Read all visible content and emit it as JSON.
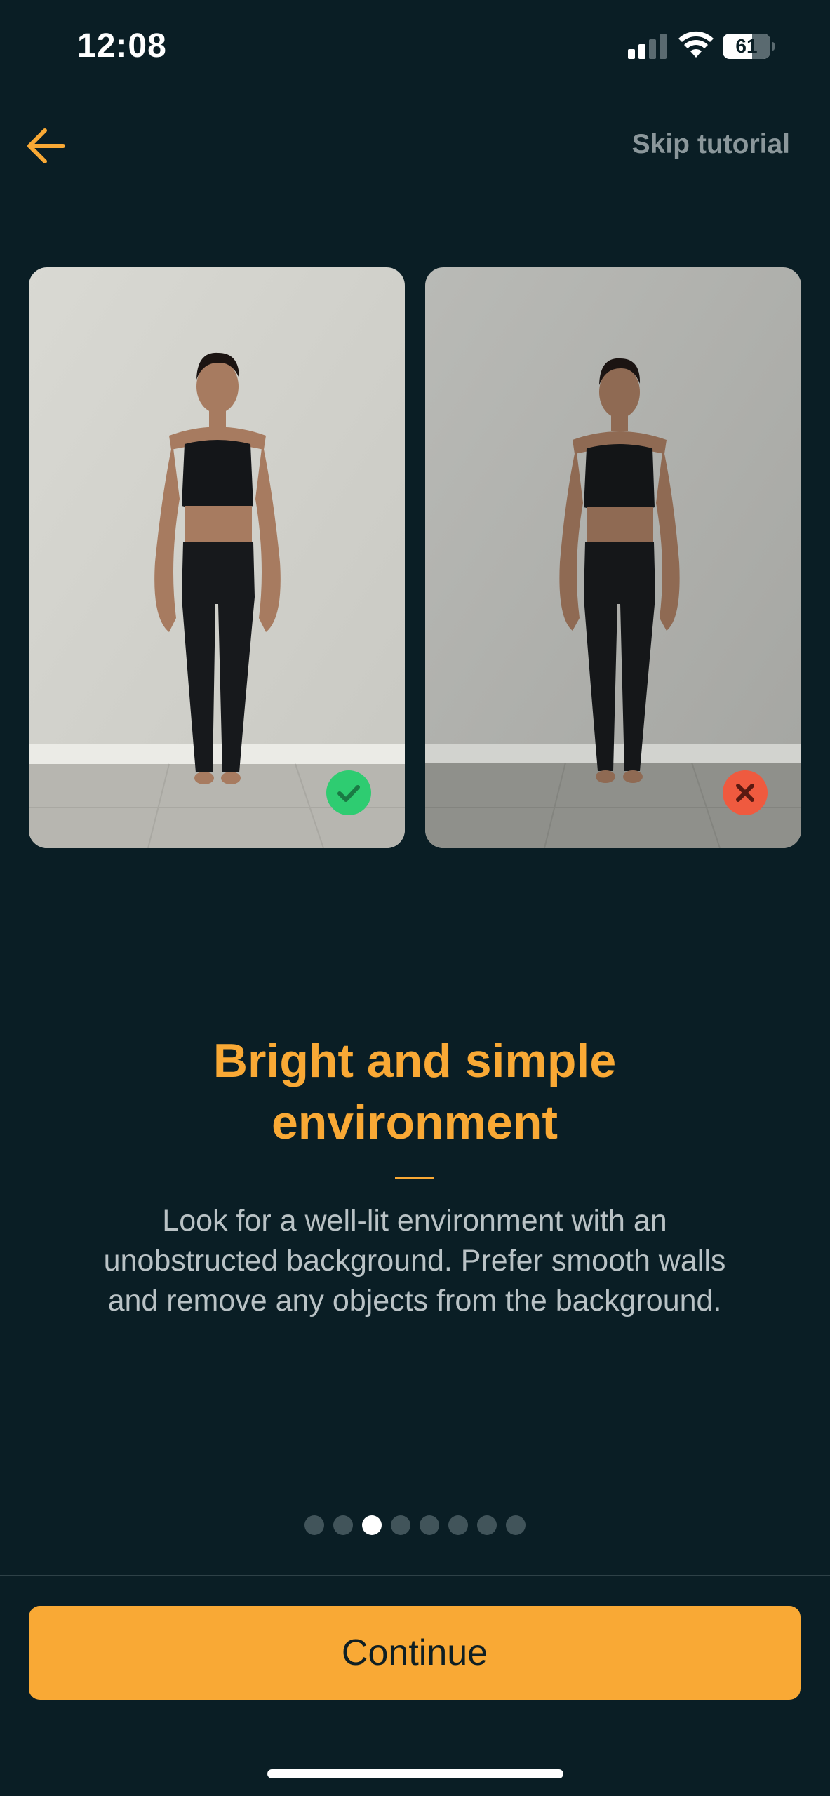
{
  "status_bar": {
    "time": "12:08",
    "battery_level": "61",
    "icons": [
      "signal-icon",
      "wifi-icon",
      "battery-icon"
    ]
  },
  "nav": {
    "back_icon": "arrow-left-icon",
    "skip_label": "Skip tutorial"
  },
  "photos": {
    "good_badge_icon": "check-icon",
    "bad_badge_icon": "close-icon"
  },
  "content": {
    "title_line1": "Bright and simple",
    "title_line2": "environment",
    "description": "Look for a well-lit environment with an unobstructed background. Prefer smooth walls and remove any objects from the background."
  },
  "pagination": {
    "total": 8,
    "current": 3
  },
  "continue_label": "Continue",
  "colors": {
    "background": "#0a1e25",
    "accent": "#f9a935",
    "success": "#2ecc71",
    "error": "#ef5a3f",
    "muted_text": "#8b979b"
  }
}
